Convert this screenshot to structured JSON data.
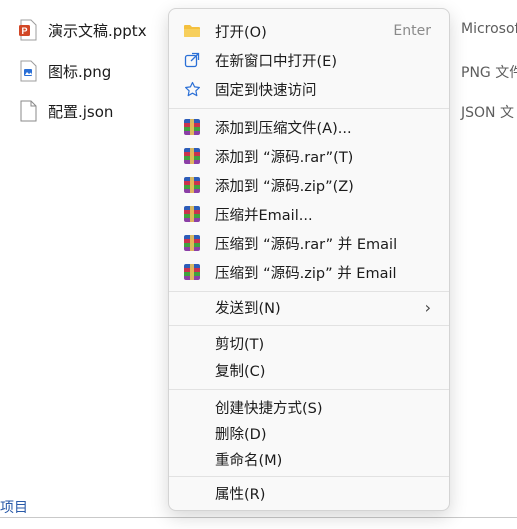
{
  "files": [
    {
      "name": "演示文稿.pptx",
      "type": "Microsof",
      "icon": "pptx-file-icon"
    },
    {
      "name": "图标.png",
      "type": "PNG 文件",
      "icon": "png-file-icon"
    },
    {
      "name": "配置.json",
      "type": "JSON 文",
      "icon": "json-file-icon"
    }
  ],
  "status_text": "项目",
  "menu": {
    "open": {
      "label": "打开(O)",
      "shortcut": "Enter"
    },
    "open_new_window": "在新窗口中打开(E)",
    "pin_quick_access": "固定到快速访问",
    "add_archive": "添加到压缩文件(A)...",
    "add_rar": "添加到 “源码.rar”(T)",
    "add_zip": "添加到 “源码.zip”(Z)",
    "compress_email": "压缩并Email...",
    "compress_rar_email": "压缩到 “源码.rar” 并 Email",
    "compress_zip_email": "压缩到 “源码.zip” 并 Email",
    "send_to": "发送到(N)",
    "cut": "剪切(T)",
    "copy": "复制(C)",
    "create_shortcut": "创建快捷方式(S)",
    "delete": "删除(D)",
    "rename": "重命名(M)",
    "properties": "属性(R)"
  },
  "colors": {
    "accent": "#2a5aa8",
    "pptx": "#d24726",
    "folder": "#f4c03e",
    "star": "#2a6fd6"
  }
}
